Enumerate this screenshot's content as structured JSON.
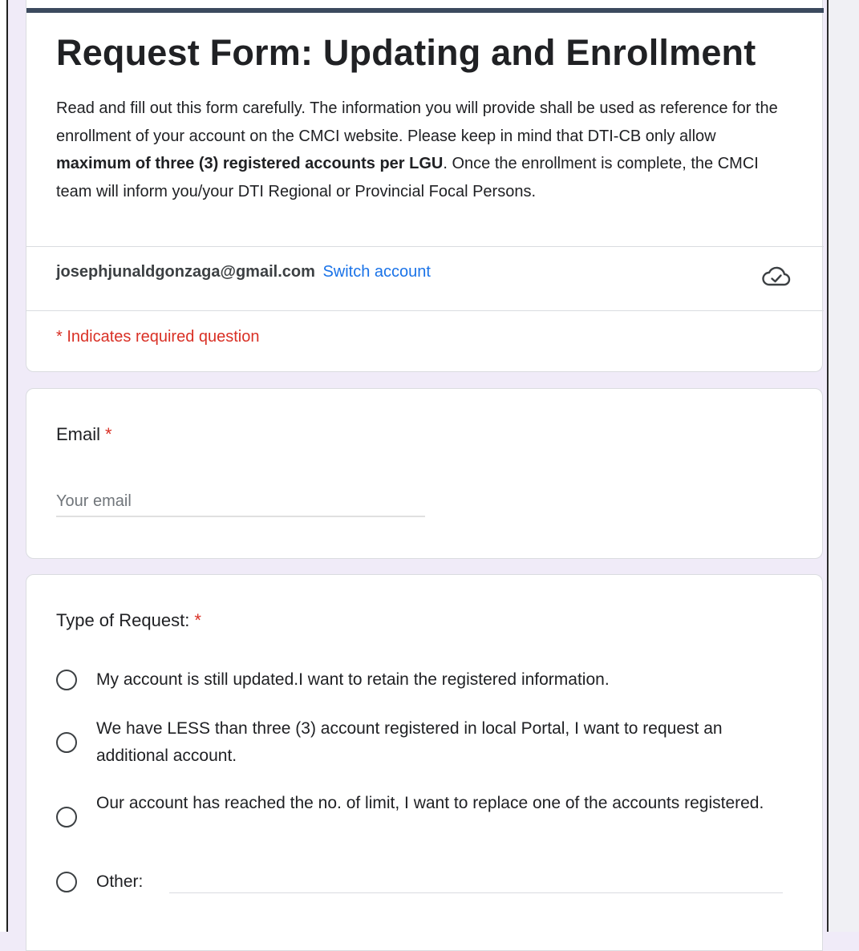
{
  "form": {
    "title": "Request Form: Updating and Enrollment",
    "description": {
      "part1": "Read and fill out this form carefully. The information you will provide shall be used as reference for the enrollment of your account on the CMCI website. Please keep in mind that DTI-CB only allow ",
      "bold": "maximum of three (3) registered accounts per LGU",
      "part2": ". Once the enrollment is complete, the CMCI team will inform you/your DTI Regional or Provincial Focal Persons."
    },
    "accent_color": "#3c4a5e"
  },
  "account": {
    "email": "josephjunaldgonzaga@gmail.com",
    "switch_label": "Switch account",
    "saved_icon": "cloud-check-icon"
  },
  "required_note": "* Indicates required question",
  "questions": {
    "email": {
      "label": "Email",
      "required_mark": "*",
      "placeholder": "Your email",
      "value": ""
    },
    "request_type": {
      "label": "Type of Request:",
      "required_mark": "*",
      "options": [
        {
          "label": "My account is still updated.I want to retain the registered information."
        },
        {
          "label": "We have LESS than three (3)  account registered in local Portal, I want to request an additional account."
        },
        {
          "label": "Our account has reached the no. of limit, I want to replace one of the accounts registered."
        },
        {
          "label": "Other:"
        }
      ],
      "other_value": ""
    }
  },
  "colors": {
    "required": "#d93025",
    "link": "#1a73e8",
    "page_background": "#f0ebf8"
  }
}
